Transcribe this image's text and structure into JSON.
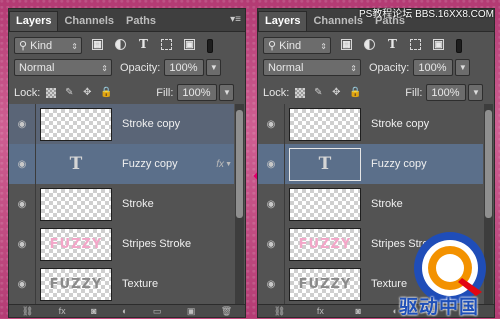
{
  "watermark": "PS教程论坛 BBS.16XX8.COM",
  "logo_text": "驱动中国",
  "panels": [
    {
      "tabs": [
        "Layers",
        "Channels",
        "Paths"
      ],
      "kind_label": "Kind",
      "blend_mode": "Normal",
      "opacity_label": "Opacity:",
      "opacity_value": "100%",
      "lock_label": "Lock:",
      "fill_label": "Fill:",
      "fill_value": "100%",
      "layers": [
        {
          "name": "Stroke copy",
          "thumb": "checker",
          "selected": true
        },
        {
          "name": "Fuzzy copy",
          "thumb": "T",
          "selected": true,
          "fx": "fx"
        },
        {
          "name": "Stroke",
          "thumb": "checker"
        },
        {
          "name": "Stripes Stroke",
          "thumb": "word-pink",
          "thumb_text": "FUZZY"
        },
        {
          "name": "Texture",
          "thumb": "word-gray",
          "thumb_text": "FUZZY"
        }
      ]
    },
    {
      "tabs": [
        "Layers",
        "Channels",
        "Paths"
      ],
      "kind_label": "Kind",
      "blend_mode": "Normal",
      "opacity_label": "Opacity:",
      "opacity_value": "100%",
      "lock_label": "Lock:",
      "fill_label": "Fill:",
      "fill_value": "100%",
      "layers": [
        {
          "name": "Stroke copy",
          "thumb": "checker"
        },
        {
          "name": "Fuzzy copy",
          "thumb": "T-framed",
          "selected": true
        },
        {
          "name": "Stroke",
          "thumb": "checker"
        },
        {
          "name": "Stripes Stroke",
          "thumb": "word-pink",
          "thumb_text": "FUZZY"
        },
        {
          "name": "Texture",
          "thumb": "word-gray",
          "thumb_text": "FUZZY"
        }
      ]
    }
  ],
  "colors": {
    "selected_layer": "#5b6f8a",
    "accent": "#e0006e"
  }
}
